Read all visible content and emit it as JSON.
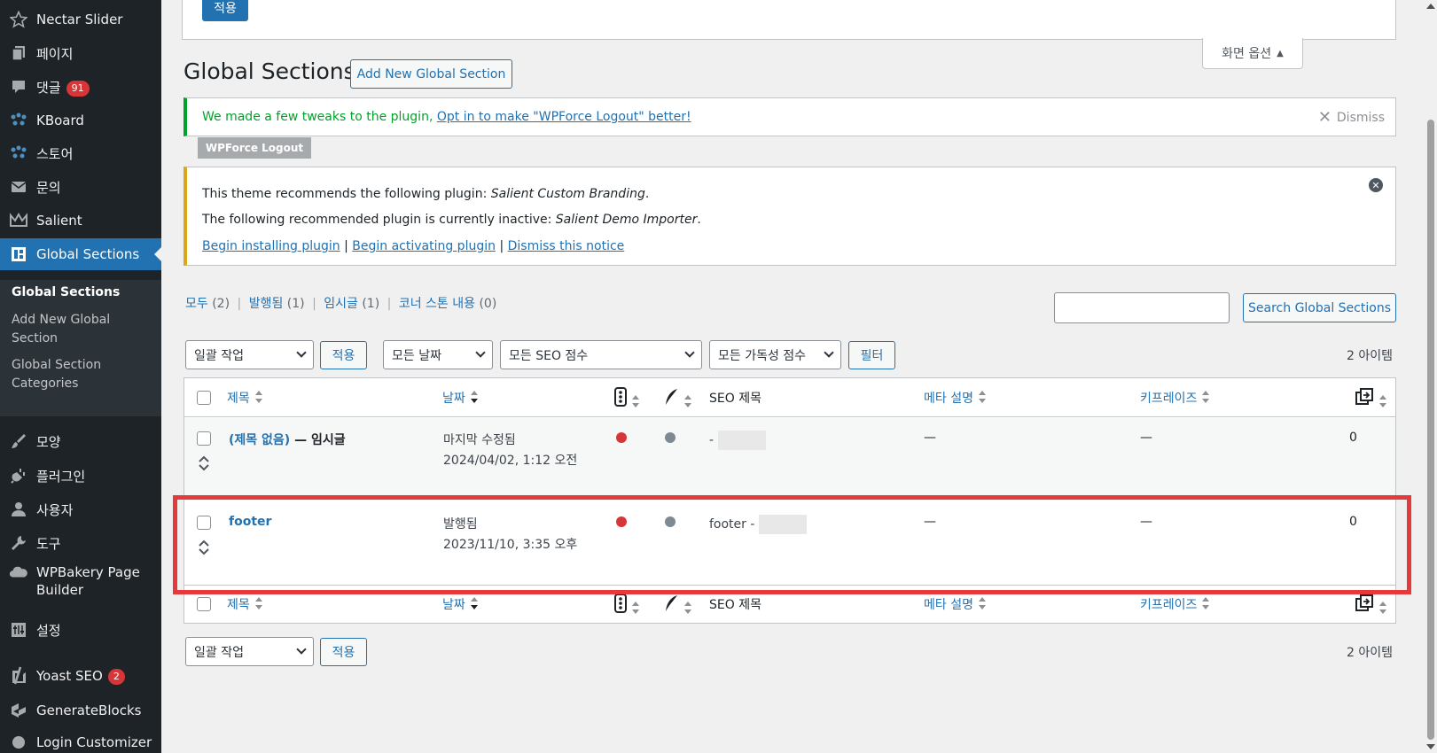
{
  "sidebar": {
    "items": [
      {
        "label": "Nectar Slider",
        "icon": "star-icon"
      },
      {
        "label": "페이지",
        "icon": "pages-icon"
      },
      {
        "label": "댓글",
        "icon": "comments-icon",
        "badge": "91"
      },
      {
        "label": "KBoard",
        "icon": "kboard-icon"
      },
      {
        "label": "스토어",
        "icon": "store-icon"
      },
      {
        "label": "문의",
        "icon": "mail-icon"
      },
      {
        "label": "Salient",
        "icon": "crown-icon"
      },
      {
        "label": "Global Sections",
        "icon": "layout-icon"
      },
      {
        "label": "모양",
        "icon": "brush-icon"
      },
      {
        "label": "플러그인",
        "icon": "plugin-icon"
      },
      {
        "label": "사용자",
        "icon": "user-icon"
      },
      {
        "label": "도구",
        "icon": "wrench-icon"
      },
      {
        "label": "WPBakery Page Builder",
        "icon": "cloud-icon"
      },
      {
        "label": "설정",
        "icon": "settings-icon"
      },
      {
        "label": "Yoast SEO",
        "icon": "yoast-icon",
        "badge": "2"
      },
      {
        "label": "GenerateBlocks",
        "icon": "generateblocks-icon"
      },
      {
        "label": "Login Customizer",
        "icon": "login-icon"
      }
    ],
    "submenu": [
      "Global Sections",
      "Add New Global Section",
      "Global Section Categories"
    ]
  },
  "top": {
    "apply_label": "적용",
    "screen_options": "화면 옵션"
  },
  "page": {
    "title": "Global Sections",
    "add_new": "Add New Global Section"
  },
  "notice1": {
    "text": "We made a few tweaks to the plugin, ",
    "link": "Opt in to make \"WPForce Logout\" better!",
    "dismiss": "Dismiss",
    "tag": "WPForce Logout"
  },
  "notice2": {
    "line1_prefix": "This theme recommends the following plugin: ",
    "line1_plugin": "Salient Custom Branding",
    "line2_prefix": "The following recommended plugin is currently inactive: ",
    "line2_plugin": "Salient Demo Importer",
    "links": [
      "Begin installing plugin",
      "Begin activating plugin",
      "Dismiss this notice"
    ]
  },
  "filters": {
    "views": [
      {
        "label": "모두",
        "count": "(2)"
      },
      {
        "label": "발행됨",
        "count": "(1)"
      },
      {
        "label": "임시글",
        "count": "(1)"
      },
      {
        "label": "코너 스톤 내용",
        "count": "(0)"
      }
    ],
    "search_button": "Search Global Sections",
    "bulk_action": "일괄 작업",
    "apply": "적용",
    "all_dates": "모든 날짜",
    "all_seo": "모든 SEO 점수",
    "all_readability": "모든 가독성 점수",
    "filter": "필터",
    "item_count": "2 아이템"
  },
  "table": {
    "columns": [
      "제목",
      "날짜",
      "SEO 제목",
      "메타 설명",
      "키프레이즈"
    ],
    "rows": [
      {
        "title": "(제목 없음)",
        "state": " — 임시글",
        "date_status": "마지막 수정됨",
        "date": "2024/04/02, 1:12 오전",
        "seo_title": "- ",
        "meta": "—",
        "keyphrase": "—",
        "links": "0"
      },
      {
        "title": "footer",
        "state": "",
        "date_status": "발행됨",
        "date": "2023/11/10, 3:35 오후",
        "seo_title": "footer - ",
        "meta": "—",
        "keyphrase": "—",
        "links": "0"
      }
    ]
  },
  "colors": {
    "accent": "#2271b1",
    "sidebar_bg": "#1d2327",
    "seo_red": "#d63638",
    "highlight": "#e5393c"
  }
}
